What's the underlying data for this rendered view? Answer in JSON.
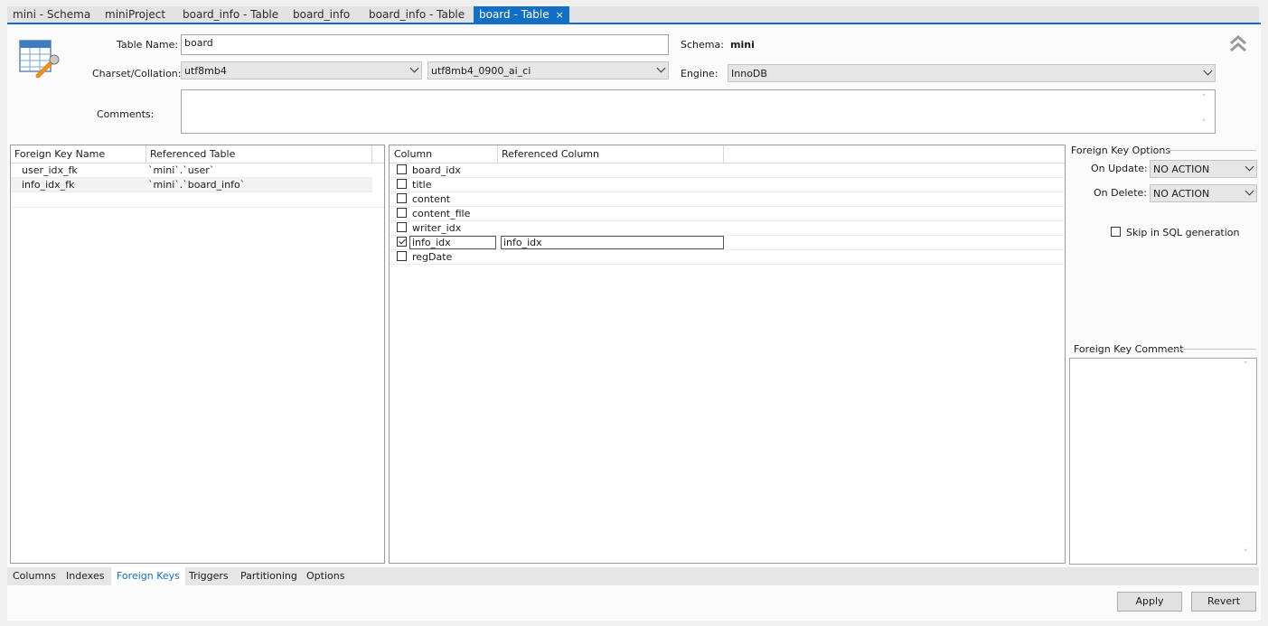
{
  "tabs": [
    {
      "label": "mini - Schema"
    },
    {
      "label": "miniProject"
    },
    {
      "label": "board_info - Table"
    },
    {
      "label": "board_info"
    },
    {
      "label": "board_info - Table"
    },
    {
      "label": "board - Table",
      "close": "×"
    }
  ],
  "header": {
    "table_name_label": "Table Name:",
    "table_name_value": "board",
    "schema_label": "Schema:",
    "schema_value": "mini",
    "charset_label": "Charset/Collation:",
    "charset_value": "utf8mb4",
    "collation_value": "utf8mb4_0900_ai_ci",
    "engine_label": "Engine:",
    "engine_value": "InnoDB",
    "comments_label": "Comments:",
    "comments_value": ""
  },
  "fk_list": {
    "col_name": "Foreign Key Name",
    "col_table": "Referenced Table",
    "rows": [
      {
        "name": "user_idx_fk",
        "table": "`mini`.`user`"
      },
      {
        "name": "info_idx_fk",
        "table": "`mini`.`board_info`"
      }
    ]
  },
  "columns": {
    "col_column": "Column",
    "col_ref": "Referenced Column",
    "rows": [
      {
        "name": "board_idx",
        "checked": false,
        "ref": ""
      },
      {
        "name": "title",
        "checked": false,
        "ref": ""
      },
      {
        "name": "content",
        "checked": false,
        "ref": ""
      },
      {
        "name": "content_file",
        "checked": false,
        "ref": ""
      },
      {
        "name": "writer_idx",
        "checked": false,
        "ref": ""
      },
      {
        "name": "info_idx",
        "checked": true,
        "ref": "info_idx"
      },
      {
        "name": "regDate",
        "checked": false,
        "ref": ""
      }
    ]
  },
  "options": {
    "title": "Foreign Key Options",
    "on_update_label": "On Update:",
    "on_update_value": "NO ACTION",
    "on_delete_label": "On Delete:",
    "on_delete_value": "NO ACTION",
    "skip_label": "Skip in SQL generation",
    "comment_title": "Foreign Key Comment"
  },
  "bottom_tabs": [
    {
      "label": "Columns"
    },
    {
      "label": "Indexes"
    },
    {
      "label": "Foreign Keys",
      "active": true
    },
    {
      "label": "Triggers"
    },
    {
      "label": "Partitioning"
    },
    {
      "label": "Options"
    }
  ],
  "buttons": {
    "apply": "Apply",
    "revert": "Revert"
  },
  "colors": {
    "accent": "#1170c5"
  }
}
